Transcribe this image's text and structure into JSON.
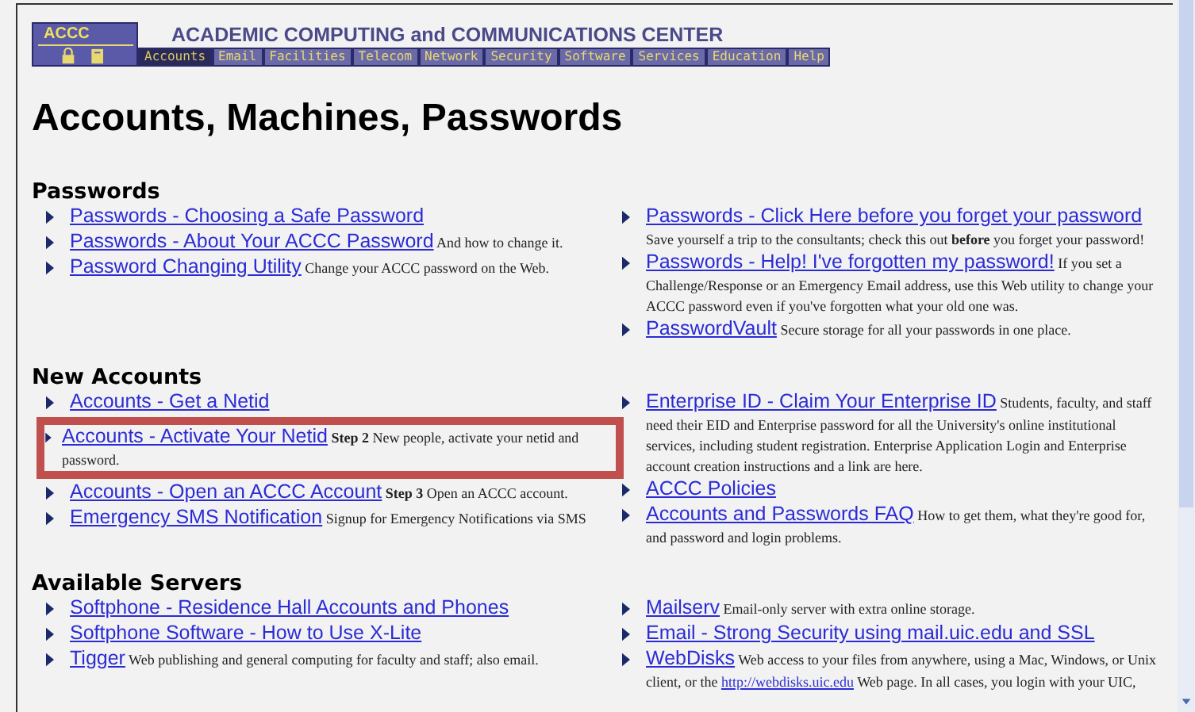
{
  "header": {
    "logo": "ACCC",
    "title": "ACADEMIC COMPUTING and COMMUNICATIONS CENTER",
    "tabs": [
      {
        "label": "Accounts",
        "selected": true
      },
      {
        "label": "Email",
        "selected": false
      },
      {
        "label": "Facilities",
        "selected": false
      },
      {
        "label": "Telecom",
        "selected": false
      },
      {
        "label": "Network",
        "selected": false
      },
      {
        "label": "Security",
        "selected": false
      },
      {
        "label": "Software",
        "selected": false
      },
      {
        "label": "Services",
        "selected": false
      },
      {
        "label": "Education",
        "selected": false
      },
      {
        "label": "Help",
        "selected": false
      }
    ]
  },
  "page_title": "Accounts, Machines, Passwords",
  "sections": [
    {
      "heading": "Passwords",
      "left": [
        {
          "link": "Passwords - Choosing a Safe Password",
          "highlighted": false
        },
        {
          "link": "Passwords - About Your ACCC Password",
          "description": "And how to change it.",
          "highlighted": false
        },
        {
          "link": "Password Changing Utility",
          "description": "Change your ACCC password on the Web.",
          "highlighted": false
        }
      ],
      "right": [
        {
          "link": "Passwords - Click Here before you forget your password",
          "description": "Save yourself a trip to the consultants; check this out **before** you forget your password!",
          "highlighted": false
        },
        {
          "link": "Passwords - Help! I've forgotten my password!",
          "description": "If you set a Challenge/Response or an Emergency Email address, use this Web utility to change your ACCC password even if you've forgotten what your old one was.",
          "highlighted": false
        },
        {
          "link": "PasswordVault",
          "description": "Secure storage for all your passwords in one place.",
          "highlighted": false
        }
      ]
    },
    {
      "heading": "New Accounts",
      "left": [
        {
          "link": "Accounts - Get a Netid",
          "highlighted": false
        },
        {
          "link": "Accounts - Activate Your Netid",
          "description": "**Step 2** New people, activate your netid and password.",
          "highlighted": true
        },
        {
          "link": "Accounts - Open an ACCC Account",
          "description": "**Step 3** Open an ACCC account.",
          "highlighted": false
        },
        {
          "link": "Emergency SMS Notification",
          "description": "Signup for Emergency Notifications via SMS",
          "highlighted": false
        }
      ],
      "right": [
        {
          "link": "Enterprise ID - Claim Your Enterprise ID",
          "description": "Students, faculty, and staff need their EID and Enterprise password for all the University's online institutional services, including student registration. Enterprise Application Login and Enterprise account creation instructions and a link are here.",
          "highlighted": false
        },
        {
          "link": "ACCC Policies",
          "highlighted": false
        },
        {
          "link": "Accounts and Passwords FAQ",
          "description": "How to get them, what they're good for, and password and login problems.",
          "highlighted": false
        }
      ]
    },
    {
      "heading": "Available Servers",
      "left": [
        {
          "link": "Softphone - Residence Hall Accounts and Phones",
          "highlighted": false
        },
        {
          "link": "Softphone Software - How to Use X-Lite",
          "highlighted": false
        },
        {
          "link": "Tigger",
          "description": "Web publishing and general computing for faculty and staff; also email.",
          "highlighted": false
        }
      ],
      "right": [
        {
          "link": "Mailserv",
          "description": "Email-only server with extra online storage.",
          "highlighted": false
        },
        {
          "link": "Email - Strong Security using mail.uic.edu and SSL",
          "highlighted": false
        },
        {
          "link": "WebDisks",
          "description": "Web access to your files from anywhere, using a Mac, Windows, or Unix client, or the",
          "inline_link": "http://webdisks.uic.edu",
          "description_end": "Web page. In all cases, you login with your UIC,",
          "highlighted": false
        }
      ]
    }
  ]
}
